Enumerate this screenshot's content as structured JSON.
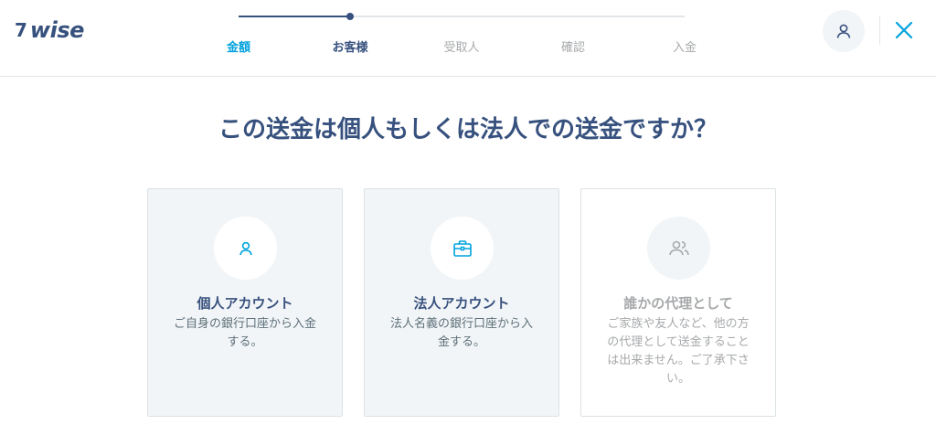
{
  "brand": {
    "flag": "7",
    "word": "wise"
  },
  "stepper": {
    "steps": [
      {
        "label": "金額"
      },
      {
        "label": "お客様"
      },
      {
        "label": "受取人"
      },
      {
        "label": "確認"
      },
      {
        "label": "入金"
      }
    ],
    "progress_fraction": 0.25
  },
  "header": {
    "user_icon": "user-icon",
    "close_icon": "close-icon"
  },
  "page": {
    "title": "この送金は個人もしくは法人での送金ですか？"
  },
  "options": [
    {
      "icon": "person-icon",
      "title": "個人アカウント",
      "desc": "ご自身の銀行口座から入金する。"
    },
    {
      "icon": "briefcase-icon",
      "title": "法人アカウント",
      "desc": "法人名義の銀行口座から入金する。"
    },
    {
      "icon": "people-icon",
      "title": "誰かの代理として",
      "desc": "ご家族や友人など、他の方の代理として送金することは出来ません。ご了承下さい。"
    }
  ],
  "colors": {
    "primary": "#37517e",
    "accent": "#00a2dd",
    "muted": "#a7a9ab",
    "card_bg": "#f2f5f7"
  }
}
